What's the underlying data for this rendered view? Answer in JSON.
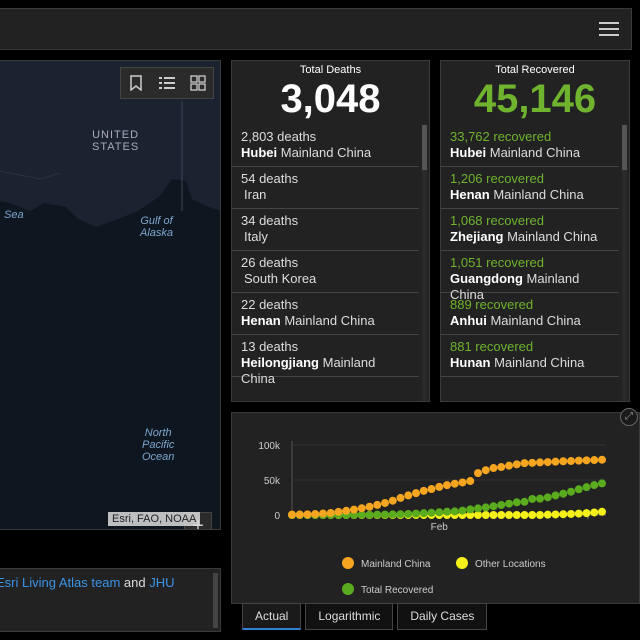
{
  "map": {
    "labels": {
      "united_states": "UNITED\nSTATES",
      "sea": "Sea",
      "gulf": "Gulf of\nAlaska",
      "pacific": "North\nPacific\nOcean"
    },
    "attribution": "Esri, FAO, NOAA",
    "zoom_in": "+",
    "zoom_out": "−"
  },
  "source": {
    "link1": "Esri Living Atlas team",
    "and_text": " and ",
    "link2": "JHU"
  },
  "deaths": {
    "title": "Total Deaths",
    "total": "3,048",
    "items": [
      {
        "value": "2,803 deaths",
        "region": "Hubei",
        "country": " Mainland China"
      },
      {
        "value": "54 deaths",
        "region": "",
        "country": "Iran"
      },
      {
        "value": "34 deaths",
        "region": "",
        "country": "Italy"
      },
      {
        "value": "26 deaths",
        "region": "",
        "country": "South Korea"
      },
      {
        "value": "22 deaths",
        "region": "Henan",
        "country": " Mainland China"
      },
      {
        "value": "13 deaths",
        "region": "Heilongjiang",
        "country": " Mainland China"
      }
    ]
  },
  "recovered": {
    "title": "Total Recovered",
    "total": "45,146",
    "items": [
      {
        "value": "33,762 recovered",
        "region": "Hubei",
        "country": " Mainland China"
      },
      {
        "value": "1,206 recovered",
        "region": "Henan",
        "country": " Mainland China"
      },
      {
        "value": "1,068 recovered",
        "region": "Zhejiang",
        "country": " Mainland China"
      },
      {
        "value": "1,051 recovered",
        "region": "Guangdong",
        "country": " Mainland China"
      },
      {
        "value": "889 recovered",
        "region": "Anhui",
        "country": " Mainland China"
      },
      {
        "value": "881 recovered",
        "region": "Hunan",
        "country": " Mainland China"
      }
    ]
  },
  "colors": {
    "deaths_value": "#dddddd",
    "recovered_value": "#6fb32e",
    "mainland": "#f5a51f",
    "other": "#f5f01a",
    "recovered": "#5aab1e"
  },
  "tabs": [
    "Actual",
    "Logarithmic",
    "Daily Cases"
  ],
  "chart_data": {
    "type": "line",
    "x": [
      1,
      2,
      3,
      4,
      5,
      6,
      7,
      8,
      9,
      10,
      11,
      12,
      13,
      14,
      15,
      16,
      17,
      18,
      19,
      20,
      21,
      22,
      23,
      24,
      25,
      26,
      27,
      28,
      29,
      30,
      31,
      32,
      33,
      34,
      35,
      36,
      37,
      38,
      39,
      40,
      41
    ],
    "x_tick_label": "Feb",
    "x_tick_index": 19,
    "ylim": [
      0,
      100000
    ],
    "y_ticks": [
      "0",
      "50k",
      "100k"
    ],
    "legend": [
      "Mainland China",
      "Other Locations",
      "Total Recovered"
    ],
    "series": [
      {
        "name": "Mainland China",
        "color": "#f5a51f",
        "values": [
          550,
          650,
          900,
          1400,
          2100,
          2900,
          4500,
          6000,
          7700,
          9700,
          11800,
          14400,
          17200,
          20400,
          24400,
          28000,
          31200,
          34500,
          37100,
          40200,
          42700,
          44700,
          46500,
          48500,
          59800,
          64000,
          67100,
          68500,
          70500,
          72400,
          74100,
          74500,
          75100,
          75600,
          76200,
          76800,
          77100,
          77700,
          78100,
          78500,
          79000
        ]
      },
      {
        "name": "Other Locations",
        "color": "#f5f01a",
        "values": [
          0,
          0,
          0,
          0,
          0,
          0,
          0,
          0,
          0,
          0,
          0,
          0,
          0,
          0,
          0,
          0,
          0,
          0,
          0,
          0,
          0,
          0,
          0,
          0,
          0,
          0,
          0,
          0,
          0,
          0,
          0,
          0,
          0,
          500,
          800,
          1100,
          1500,
          2000,
          2700,
          3600,
          4600
        ]
      },
      {
        "name": "Total Recovered",
        "color": "#5aab1e",
        "values": [
          28,
          30,
          36,
          39,
          52,
          61,
          107,
          126,
          143,
          222,
          284,
          472,
          623,
          852,
          1124,
          1487,
          2011,
          2616,
          3244,
          3946,
          4683,
          5150,
          6295,
          8058,
          9395,
          10865,
          12583,
          14352,
          16121,
          18177,
          18890,
          22886,
          23394,
          25227,
          27905,
          30384,
          33277,
          36711,
          39782,
          42716,
          45146
        ]
      }
    ]
  }
}
